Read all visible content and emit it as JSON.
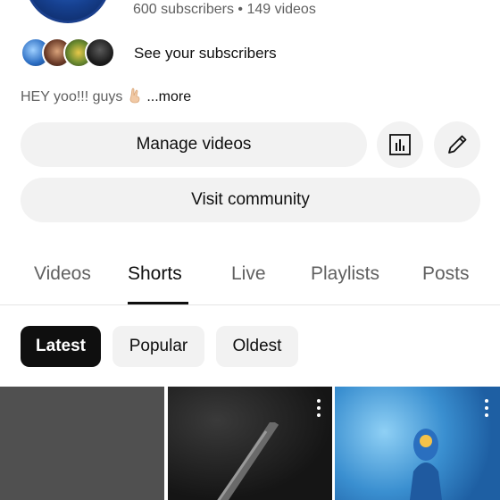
{
  "channel": {
    "stats": "600 subscribers • 149 videos",
    "see_subscribers": "See your subscribers",
    "bio_text": "HEY yoo!!! guys",
    "bio_more": "...more"
  },
  "actions": {
    "manage_videos": "Manage videos",
    "visit_community": "Visit community",
    "analytics_icon": "analytics-bar-chart-icon",
    "edit_icon": "pencil-edit-icon"
  },
  "tabs": [
    {
      "label": "Videos",
      "active": false
    },
    {
      "label": "Shorts",
      "active": true
    },
    {
      "label": "Live",
      "active": false
    },
    {
      "label": "Playlists",
      "active": false
    },
    {
      "label": "Posts",
      "active": false
    }
  ],
  "sort_chips": [
    {
      "label": "Latest",
      "selected": true
    },
    {
      "label": "Popular",
      "selected": false
    },
    {
      "label": "Oldest",
      "selected": false
    }
  ],
  "colors": {
    "accent": "#0f0f0f",
    "secondary_text": "#606060",
    "button_bg": "#f2f2f2"
  }
}
